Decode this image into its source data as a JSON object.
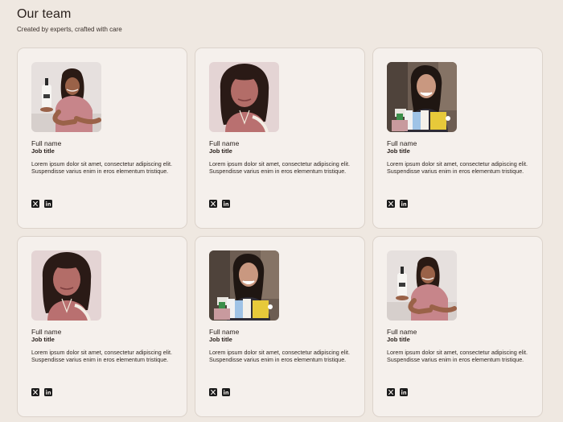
{
  "header": {
    "title": "Our team",
    "subtitle": "Created by experts, crafted with care"
  },
  "members": [
    {
      "name": "Full name",
      "job_title": "Job title",
      "bio": "Lorem ipsum dolor sit amet, consectetur adipiscing elit. Suspendisse varius enim in eros elementum tristique.",
      "photo": "woman-holding-bottle"
    },
    {
      "name": "Full name",
      "job_title": "Job title",
      "bio": "Lorem ipsum dolor sit amet, consectetur adipiscing elit. Suspendisse varius enim in eros elementum tristique.",
      "photo": "woman-closeup-pink"
    },
    {
      "name": "Full name",
      "job_title": "Job title",
      "bio": "Lorem ipsum dolor sit amet, consectetur adipiscing elit. Suspendisse varius enim in eros elementum tristique.",
      "photo": "woman-with-products"
    },
    {
      "name": "Full name",
      "job_title": "Job title",
      "bio": "Lorem ipsum dolor sit amet, consectetur adipiscing elit. Suspendisse varius enim in eros elementum tristique.",
      "photo": "woman-closeup-pink"
    },
    {
      "name": "Full name",
      "job_title": "Job title",
      "bio": "Lorem ipsum dolor sit amet, consectetur adipiscing elit. Suspendisse varius enim in eros elementum tristique.",
      "photo": "woman-with-products"
    },
    {
      "name": "Full name",
      "job_title": "Job title",
      "bio": "Lorem ipsum dolor sit amet, consectetur adipiscing elit. Suspendisse varius enim in eros elementum tristique.",
      "photo": "woman-holding-bottle"
    }
  ],
  "socials": [
    {
      "icon": "x-twitter-icon"
    },
    {
      "icon": "linkedin-icon"
    }
  ],
  "colors": {
    "background": "#efe8e1",
    "card": "#f5f0ec",
    "card_border": "#dcd3cb",
    "text": "#2a211d",
    "icon": "#1a1a1a"
  }
}
